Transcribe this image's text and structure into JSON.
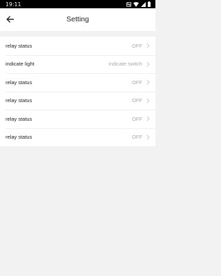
{
  "status_bar": {
    "time": "19:11",
    "icons": [
      "nfc-icon",
      "wifi-icon",
      "signal-icon",
      "battery-icon"
    ]
  },
  "header": {
    "title": "Setting",
    "back_icon": "arrow-left-icon"
  },
  "settings": [
    {
      "label": "relay status",
      "value": "OFF"
    },
    {
      "label": "indicate light",
      "value": "indicate switch"
    },
    {
      "label": "relay status",
      "value": "OFF"
    },
    {
      "label": "relay status",
      "value": "OFF"
    },
    {
      "label": "relay status",
      "value": "OFF"
    },
    {
      "label": "relay status",
      "value": "OFF"
    }
  ],
  "colors": {
    "background": "#f2f2f2",
    "surface": "#ffffff",
    "primary_text": "#222222",
    "secondary_text": "#a8a8a8",
    "chevron": "#c4c4c4",
    "status_bar": "#000000"
  }
}
